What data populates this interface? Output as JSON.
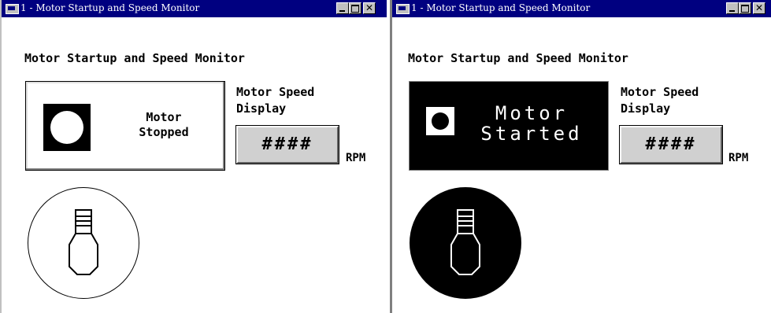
{
  "windows": [
    {
      "title": "1 - Motor Startup and Speed Monitor",
      "heading": "Motor Startup and Speed Monitor",
      "status_button": {
        "line1": "Motor",
        "line2": "Stopped",
        "state": "stopped"
      },
      "speed_label_line1": "Motor Speed",
      "speed_label_line2": "Display",
      "speed_value": "####",
      "speed_unit": "RPM",
      "motor_icon": "bulb-icon",
      "indicator_color": "#ffffff"
    },
    {
      "title": "1 - Motor Startup and Speed Monitor",
      "heading": "Motor Startup and Speed Monitor",
      "status_button": {
        "line1": "Motor",
        "line2": "Started",
        "state": "started"
      },
      "speed_label_line1": "Motor Speed",
      "speed_label_line2": "Display",
      "speed_value": "####",
      "speed_unit": "RPM",
      "motor_icon": "bulb-icon",
      "indicator_color": "#000000"
    }
  ],
  "colors": {
    "titlebar": "#000080",
    "display_bg": "#d0d0d0",
    "window_bg": "#ffffff"
  }
}
